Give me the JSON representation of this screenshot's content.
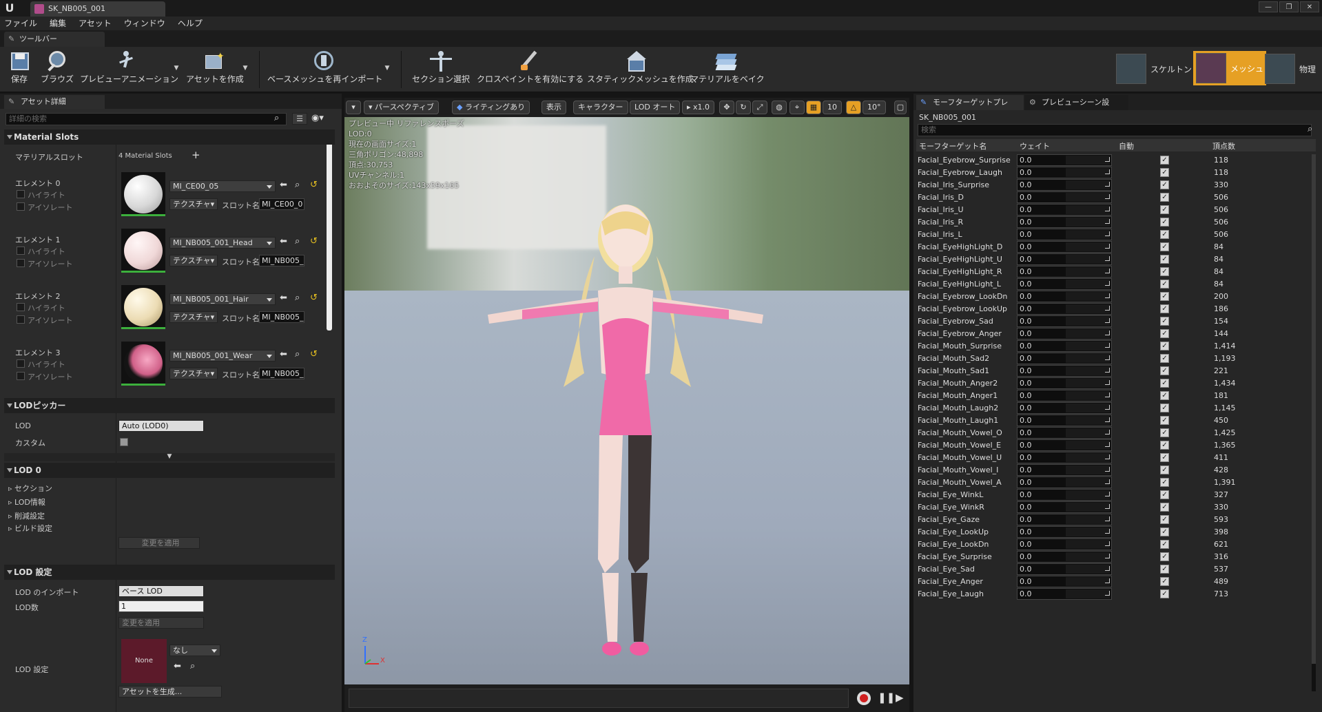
{
  "window": {
    "tab_title": "SK_NB005_001",
    "controls": [
      "—",
      "❐",
      "✕"
    ]
  },
  "menu": [
    "ファイル",
    "編集",
    "アセット",
    "ウィンドウ",
    "ヘルプ"
  ],
  "toolbar_tab": "ツールバー",
  "toolbar": {
    "save": "保存",
    "browse": "ブラウズ",
    "preview_animation": "プレビューアニメーション",
    "create_asset": "アセットを作成",
    "reimport_base_mesh": "ベースメッシュを再インポート",
    "section_select": "セクション選択",
    "enable_cloth_paint": "クロスペイントを有効にする",
    "create_static_mesh": "スタティックメッシュを作成",
    "bake_material": "マテリアルをベイク"
  },
  "modes": {
    "skeleton": "スケルトン",
    "mesh": "メッシュ",
    "physics": "物理"
  },
  "left_panel": {
    "tab": "アセット詳細",
    "search_placeholder": "詳細の検索",
    "material_slots_header": "Material Slots",
    "material_slot_label": "マテリアルスロット",
    "material_slot_count": "4 Material Slots",
    "highlight": "ハイライト",
    "isolate": "アイソレート",
    "texture_btn": "テクスチャ",
    "slot_name_label": "スロット名",
    "elements": [
      {
        "label": "エレメント 0",
        "material": "MI_CE00_05",
        "slot": "MI_CE00_0",
        "color": "#eeeeee"
      },
      {
        "label": "エレメント 1",
        "material": "MI_NB005_001_Head",
        "slot": "MI_NB005_",
        "color": "#f1e3e3"
      },
      {
        "label": "エレメント 2",
        "material": "MI_NB005_001_Hair",
        "slot": "MI_NB005_",
        "color": "#efe4c8"
      },
      {
        "label": "エレメント 3",
        "material": "MI_NB005_001_Wear",
        "slot": "MI_NB005_",
        "color": "#e78aa8"
      }
    ],
    "lod_picker_header": "LODピッカー",
    "lod_label": "LOD",
    "lod_value": "Auto (LOD0)",
    "custom_label": "カスタム",
    "lod0_header": "LOD 0",
    "lod0_items": [
      "セクション",
      "LOD情報",
      "削減設定",
      "ビルド設定"
    ],
    "apply_changes": "変更を適用",
    "lod_settings_header": "LOD 設定",
    "lod_import_label": "LOD のインポート",
    "lod_import_value": "ベース LOD",
    "lod_count_label": "LOD数",
    "lod_count_value": "1",
    "lod_settings_label": "LOD 設定",
    "lod_settings_asset": "None",
    "lod_settings_value": "なし",
    "generate_asset": "アセットを生成..."
  },
  "viewport": {
    "buttons": {
      "perspective": "パースペクティブ",
      "lit": "ライティングあり",
      "show": "表示",
      "character": "キャラクター",
      "lod_auto": "LOD オート",
      "speed": "x1.0",
      "grid": "10",
      "angle": "10°"
    },
    "stats": [
      "プレビュー中 リファレンスポーズ",
      "LOD:0",
      "現在の画面サイズ:1",
      "三角ポリゴン:48,898",
      "頂点:30,753",
      "UVチャンネル:1",
      "おおよそのサイズ:143x59x165"
    ],
    "axis": {
      "z": "Z",
      "x": "X"
    }
  },
  "right_panel": {
    "tabs": [
      "モーフターゲットプレ",
      "プレビューシーン設"
    ],
    "asset_name": "SK_NB005_001",
    "search_placeholder": "検索",
    "columns": [
      "モーフターゲット名",
      "ウェイト",
      "自動",
      "頂点数"
    ],
    "rows": [
      {
        "name": "Facial_Eyebrow_Surprise",
        "weight": "0.0",
        "verts": "118"
      },
      {
        "name": "Facial_Eyebrow_Laugh",
        "weight": "0.0",
        "verts": "118"
      },
      {
        "name": "Facial_Iris_Surprise",
        "weight": "0.0",
        "verts": "330"
      },
      {
        "name": "Facial_Iris_D",
        "weight": "0.0",
        "verts": "506"
      },
      {
        "name": "Facial_Iris_U",
        "weight": "0.0",
        "verts": "506"
      },
      {
        "name": "Facial_Iris_R",
        "weight": "0.0",
        "verts": "506"
      },
      {
        "name": "Facial_Iris_L",
        "weight": "0.0",
        "verts": "506"
      },
      {
        "name": "Facial_EyeHighLight_D",
        "weight": "0.0",
        "verts": "84"
      },
      {
        "name": "Facial_EyeHighLight_U",
        "weight": "0.0",
        "verts": "84"
      },
      {
        "name": "Facial_EyeHighLight_R",
        "weight": "0.0",
        "verts": "84"
      },
      {
        "name": "Facial_EyeHighLight_L",
        "weight": "0.0",
        "verts": "84"
      },
      {
        "name": "Facial_Eyebrow_LookDn",
        "weight": "0.0",
        "verts": "200"
      },
      {
        "name": "Facial_Eyebrow_LookUp",
        "weight": "0.0",
        "verts": "186"
      },
      {
        "name": "Facial_Eyebrow_Sad",
        "weight": "0.0",
        "verts": "154"
      },
      {
        "name": "Facial_Eyebrow_Anger",
        "weight": "0.0",
        "verts": "144"
      },
      {
        "name": "Facial_Mouth_Surprise",
        "weight": "0.0",
        "verts": "1,414"
      },
      {
        "name": "Facial_Mouth_Sad2",
        "weight": "0.0",
        "verts": "1,193"
      },
      {
        "name": "Facial_Mouth_Sad1",
        "weight": "0.0",
        "verts": "221"
      },
      {
        "name": "Facial_Mouth_Anger2",
        "weight": "0.0",
        "verts": "1,434"
      },
      {
        "name": "Facial_Mouth_Anger1",
        "weight": "0.0",
        "verts": "181"
      },
      {
        "name": "Facial_Mouth_Laugh2",
        "weight": "0.0",
        "verts": "1,145"
      },
      {
        "name": "Facial_Mouth_Laugh1",
        "weight": "0.0",
        "verts": "450"
      },
      {
        "name": "Facial_Mouth_Vowel_O",
        "weight": "0.0",
        "verts": "1,425"
      },
      {
        "name": "Facial_Mouth_Vowel_E",
        "weight": "0.0",
        "verts": "1,365"
      },
      {
        "name": "Facial_Mouth_Vowel_U",
        "weight": "0.0",
        "verts": "411"
      },
      {
        "name": "Facial_Mouth_Vowel_I",
        "weight": "0.0",
        "verts": "428"
      },
      {
        "name": "Facial_Mouth_Vowel_A",
        "weight": "0.0",
        "verts": "1,391"
      },
      {
        "name": "Facial_Eye_WinkL",
        "weight": "0.0",
        "verts": "327"
      },
      {
        "name": "Facial_Eye_WinkR",
        "weight": "0.0",
        "verts": "330"
      },
      {
        "name": "Facial_Eye_Gaze",
        "weight": "0.0",
        "verts": "593"
      },
      {
        "name": "Facial_Eye_LookUp",
        "weight": "0.0",
        "verts": "398"
      },
      {
        "name": "Facial_Eye_LookDn",
        "weight": "0.0",
        "verts": "621"
      },
      {
        "name": "Facial_Eye_Surprise",
        "weight": "0.0",
        "verts": "316"
      },
      {
        "name": "Facial_Eye_Sad",
        "weight": "0.0",
        "verts": "537"
      },
      {
        "name": "Facial_Eye_Anger",
        "weight": "0.0",
        "verts": "489"
      },
      {
        "name": "Facial_Eye_Laugh",
        "weight": "0.0",
        "verts": "713"
      }
    ]
  },
  "colors": {
    "accent_mode": "#e6a024",
    "record": "#d02020"
  }
}
